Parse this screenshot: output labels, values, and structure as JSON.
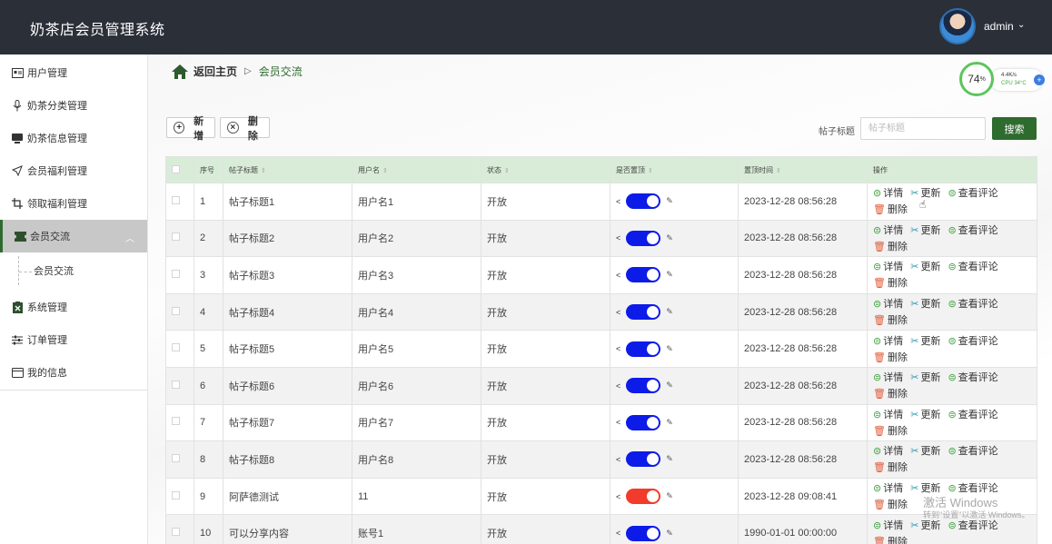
{
  "app": {
    "title": "奶茶店会员管理系统",
    "user": "admin",
    "user_caret": "⌄"
  },
  "sidebar": {
    "items": [
      {
        "label": "用户管理",
        "icon": "id-card-icon"
      },
      {
        "label": "奶茶分类管理",
        "icon": "microphone-icon"
      },
      {
        "label": "奶茶信息管理",
        "icon": "monitor-icon"
      },
      {
        "label": "会员福利管理",
        "icon": "send-icon"
      },
      {
        "label": "领取福利管理",
        "icon": "crop-icon"
      },
      {
        "label": "会员交流",
        "icon": "ticket-icon",
        "active": true
      },
      {
        "label": "系统管理",
        "icon": "clipboard-x-icon"
      },
      {
        "label": "订单管理",
        "icon": "sliders-icon"
      },
      {
        "label": "我的信息",
        "icon": "card-icon"
      }
    ],
    "submenu": {
      "label": "会员交流"
    }
  },
  "breadcrumb": {
    "home": "返回主页",
    "separator": "▷",
    "current": "会员交流"
  },
  "cpu_widget": {
    "percent": "74",
    "percent_unit": "%",
    "net": "4.4K/s",
    "cpu": "CPU 34°C",
    "plus": "+"
  },
  "toolbar": {
    "add_label": "新增",
    "delete_label": "删除"
  },
  "search": {
    "label": "帖子标题",
    "placeholder": "帖子标题",
    "value": "",
    "button": "搜索"
  },
  "table": {
    "headers": [
      "",
      "序号",
      "帖子标题",
      "用户名",
      "状态",
      "是否置顶",
      "置顶时间",
      "操作"
    ],
    "rows": [
      {
        "index": "1",
        "title": "帖子标题1",
        "user": "用户名1",
        "status": "开放",
        "pinned": true,
        "time": "2023-12-28 08:56:28"
      },
      {
        "index": "2",
        "title": "帖子标题2",
        "user": "用户名2",
        "status": "开放",
        "pinned": true,
        "time": "2023-12-28 08:56:28"
      },
      {
        "index": "3",
        "title": "帖子标题3",
        "user": "用户名3",
        "status": "开放",
        "pinned": true,
        "time": "2023-12-28 08:56:28"
      },
      {
        "index": "4",
        "title": "帖子标题4",
        "user": "用户名4",
        "status": "开放",
        "pinned": true,
        "time": "2023-12-28 08:56:28"
      },
      {
        "index": "5",
        "title": "帖子标题5",
        "user": "用户名5",
        "status": "开放",
        "pinned": true,
        "time": "2023-12-28 08:56:28"
      },
      {
        "index": "6",
        "title": "帖子标题6",
        "user": "用户名6",
        "status": "开放",
        "pinned": true,
        "time": "2023-12-28 08:56:28"
      },
      {
        "index": "7",
        "title": "帖子标题7",
        "user": "用户名7",
        "status": "开放",
        "pinned": true,
        "time": "2023-12-28 08:56:28"
      },
      {
        "index": "8",
        "title": "帖子标题8",
        "user": "用户名8",
        "status": "开放",
        "pinned": true,
        "time": "2023-12-28 08:56:28"
      },
      {
        "index": "9",
        "title": "阿萨德测试",
        "user": "11",
        "status": "开放",
        "pinned": false,
        "time": "2023-12-28 09:08:41"
      },
      {
        "index": "10",
        "title": "可以分享内容",
        "user": "账号1",
        "status": "开放",
        "pinned": true,
        "time": "1990-01-01 00:00:00"
      }
    ],
    "actions": {
      "detail": "详情",
      "update": "更新",
      "comments": "查看评论",
      "delete": "删除"
    }
  },
  "colors": {
    "topbar": "#2a2f38",
    "accent": "#2e6b2e",
    "header_bg": "#d9ecd8",
    "toggle_on": "#0d1be8",
    "toggle_off": "#f23b2b"
  },
  "watermark": {
    "line1": "激活 Windows",
    "line2": "转到\"设置\"以激活 Windows。"
  }
}
